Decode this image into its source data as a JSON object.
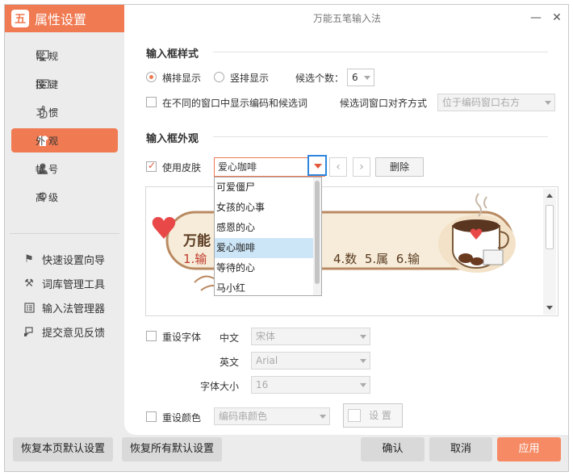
{
  "sidebar": {
    "title": "属性设置",
    "logo_glyph": "五",
    "nav": [
      {
        "label": "常规",
        "icon": "monitor-icon"
      },
      {
        "label": "按键",
        "icon": "keyboard-icon"
      },
      {
        "label": "习惯",
        "icon": "hand-icon"
      },
      {
        "label": "外观",
        "icon": "tshirt-icon"
      },
      {
        "label": "帐号",
        "icon": "user-icon"
      },
      {
        "label": "高级",
        "icon": "gear-icon"
      }
    ],
    "active_nav": "外观",
    "tools": [
      {
        "label": "快速设置向导",
        "icon": "flag-icon"
      },
      {
        "label": "词库管理工具",
        "icon": "tools-icon"
      },
      {
        "label": "输入法管理器",
        "icon": "list-icon"
      },
      {
        "label": "提交意见反馈",
        "icon": "feedback-icon"
      }
    ]
  },
  "window": {
    "title": "万能五笔输入法",
    "min_glyph": "—",
    "close_glyph": "✕"
  },
  "input_style": {
    "heading": "输入框样式",
    "horizontal_label": "横排显示",
    "vertical_label": "竖排显示",
    "orientation": "横排显示",
    "candidate_count_label": "候选个数：",
    "candidate_count": "6",
    "per_window_label": "在不同的窗口中显示编码和候选词",
    "per_window_checked": false,
    "align_label": "候选词窗口对齐方式",
    "align_value": "位于编码窗口右方"
  },
  "appearance": {
    "heading": "输入框外观",
    "use_skin_label": "使用皮肤",
    "use_skin_checked": true,
    "skin_value": "爱心咖啡",
    "prev_glyph": "‹",
    "next_glyph": "›",
    "delete_label": "删除",
    "skin_options": [
      "可爱僵尸",
      "女孩的心事",
      "感恩的心",
      "爱心咖啡",
      "等待的心",
      "马小红"
    ],
    "selected_option": "爱心咖啡",
    "preview": {
      "code_text": "万能",
      "candidates_left": "1.输",
      "candidates_right": "4.数  5.属  6.输"
    }
  },
  "font": {
    "reset_font_label": "重设字体",
    "reset_font_checked": false,
    "chinese_label": "中文",
    "chinese_value": "宋体",
    "english_label": "英文",
    "english_value": "Arial",
    "size_label": "字体大小",
    "size_value": "16"
  },
  "color": {
    "reset_color_label": "重设颜色",
    "reset_color_checked": false,
    "target_value": "编码串颜色",
    "set_label": "设 置"
  },
  "footer": {
    "restore_page": "恢复本页默认设置",
    "restore_all": "恢复所有默认设置",
    "ok": "确认",
    "cancel": "取消",
    "apply": "应用"
  },
  "colors": {
    "accent": "#f07b53",
    "apply_button": "#f58a65",
    "dropdown_selected": "#cde6f7",
    "focus_border": "#2e86de"
  }
}
